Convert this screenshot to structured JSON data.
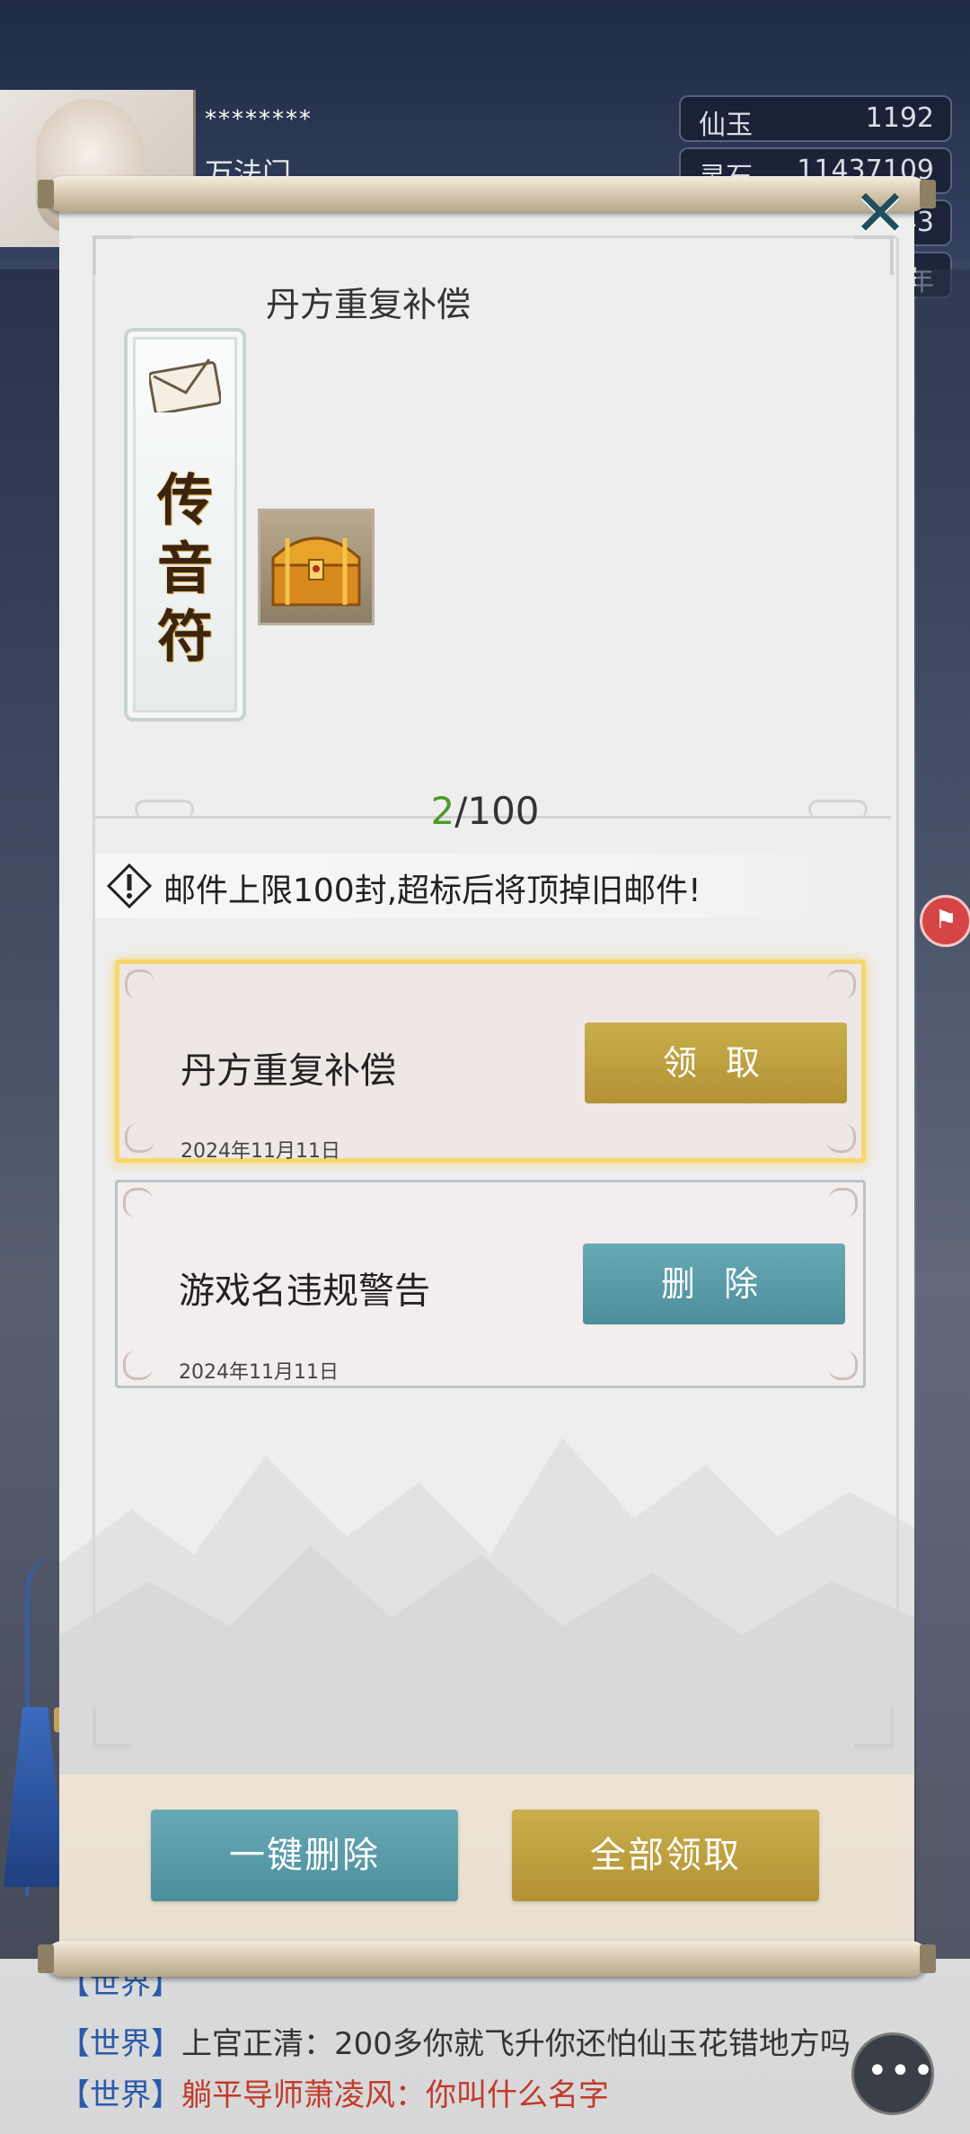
{
  "player": {
    "name": "********",
    "sect": "万法门"
  },
  "resources": [
    {
      "label": "仙玉",
      "value": "1192"
    },
    {
      "label": "灵石",
      "value": "11437109"
    },
    {
      "label": "",
      "value": "43"
    },
    {
      "label": "",
      "value": "年"
    }
  ],
  "mail_dialog": {
    "close_icon": "close-x-icon",
    "selected_mail": {
      "title": "丹方重复补偿",
      "talisman_text": [
        "传",
        "音",
        "符"
      ],
      "attachment_icon": "treasure-chest-icon"
    },
    "count": {
      "current": "2",
      "total": "/100"
    },
    "notice": "邮件上限100封,超标后将顶掉旧邮件!",
    "items": [
      {
        "title": "丹方重复补偿",
        "date": "2024年11月11日",
        "action": "领 取"
      },
      {
        "title": "游戏名违规警告",
        "date": "2024年11月11日",
        "action": "删 除"
      }
    ],
    "delete_all": "一键删除",
    "claim_all": "全部领取"
  },
  "chat": [
    {
      "channel": "【世界】",
      "name": "",
      "message": ""
    },
    {
      "channel": "【世界】",
      "name": "上官正清：",
      "message": "200多你就飞升你还怕仙玉花错地方吗"
    },
    {
      "channel": "【世界】",
      "name": "躺平导师萧凌风：",
      "message": "你叫什么名字"
    }
  ],
  "colors": {
    "gold": "#c9ae4a",
    "teal": "#5a9aa8",
    "count_green": "#4e9a2a",
    "highlight": "#f5d86b"
  }
}
